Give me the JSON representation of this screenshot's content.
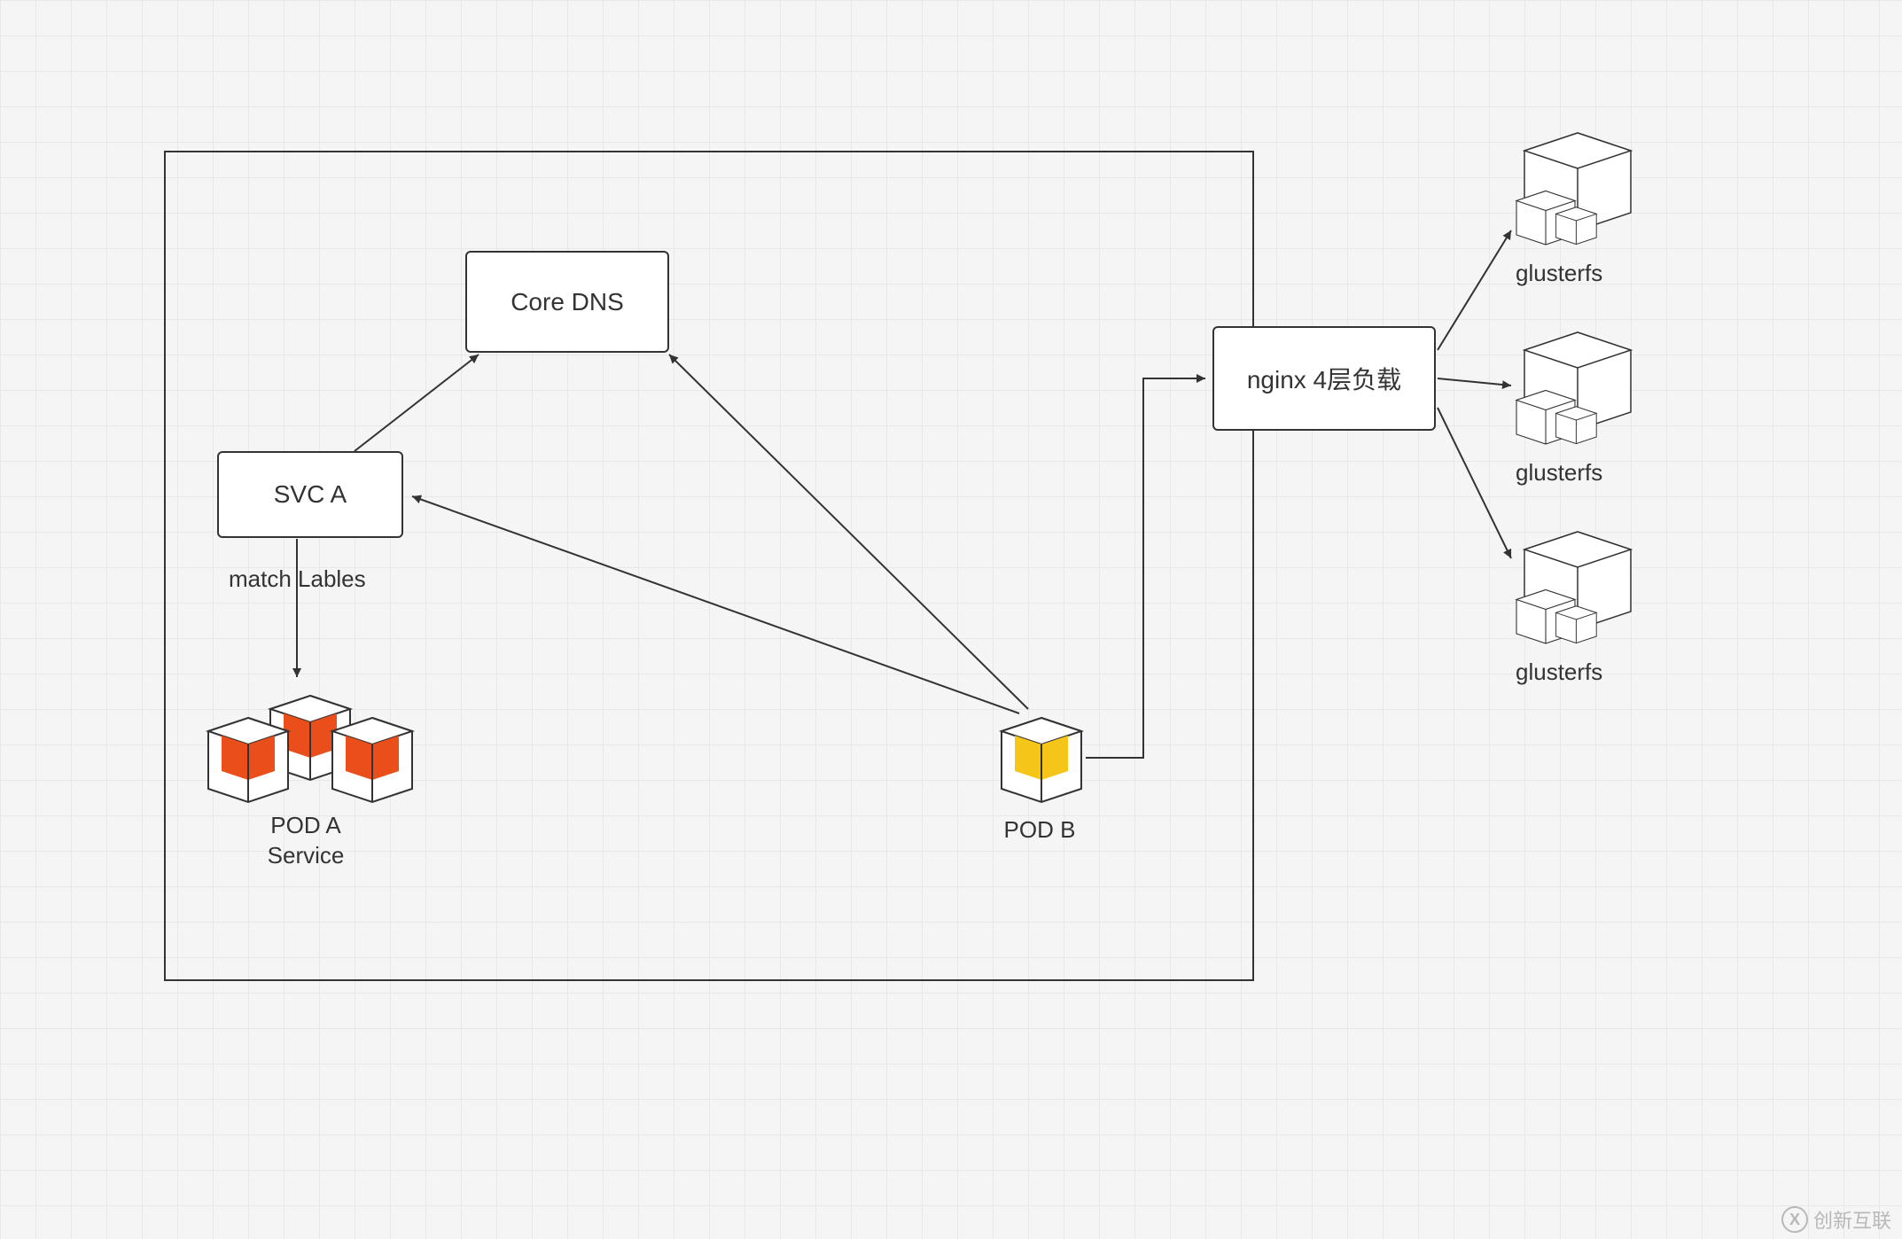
{
  "chart_data": {
    "type": "diagram",
    "title": "",
    "nodes": [
      {
        "id": "cluster",
        "type": "container",
        "label": ""
      },
      {
        "id": "coredns",
        "type": "box",
        "label": "Core DNS"
      },
      {
        "id": "svca",
        "type": "box",
        "label": "SVC A"
      },
      {
        "id": "poda",
        "type": "pod-group",
        "label": "POD A\nService",
        "count": 3,
        "color": "#e94e1b"
      },
      {
        "id": "podb",
        "type": "pod",
        "label": "POD B",
        "color": "#f5c518"
      },
      {
        "id": "nginx",
        "type": "box",
        "label": "nginx 4层负载"
      },
      {
        "id": "gfs1",
        "type": "storage-cube",
        "label": "glusterfs"
      },
      {
        "id": "gfs2",
        "type": "storage-cube",
        "label": "glusterfs"
      },
      {
        "id": "gfs3",
        "type": "storage-cube",
        "label": "glusterfs"
      }
    ],
    "edges": [
      {
        "from": "svca",
        "to": "coredns",
        "dir": "to"
      },
      {
        "from": "svca",
        "to": "poda",
        "dir": "to",
        "label": "match Lables"
      },
      {
        "from": "podb",
        "to": "coredns",
        "dir": "to"
      },
      {
        "from": "podb",
        "to": "svca",
        "dir": "to"
      },
      {
        "from": "podb",
        "to": "nginx",
        "dir": "to",
        "path": "right-up"
      },
      {
        "from": "nginx",
        "to": "gfs1",
        "dir": "to"
      },
      {
        "from": "nginx",
        "to": "gfs2",
        "dir": "to"
      },
      {
        "from": "nginx",
        "to": "gfs3",
        "dir": "to"
      }
    ]
  },
  "boxes": {
    "coredns": "Core DNS",
    "svca": "SVC A",
    "nginx": "nginx 4层负载"
  },
  "labels": {
    "match": "match Lables",
    "poda": "POD A\nService",
    "podb": "POD B",
    "gfs1": "glusterfs",
    "gfs2": "glusterfs",
    "gfs3": "glusterfs"
  },
  "watermark": "创新互联"
}
